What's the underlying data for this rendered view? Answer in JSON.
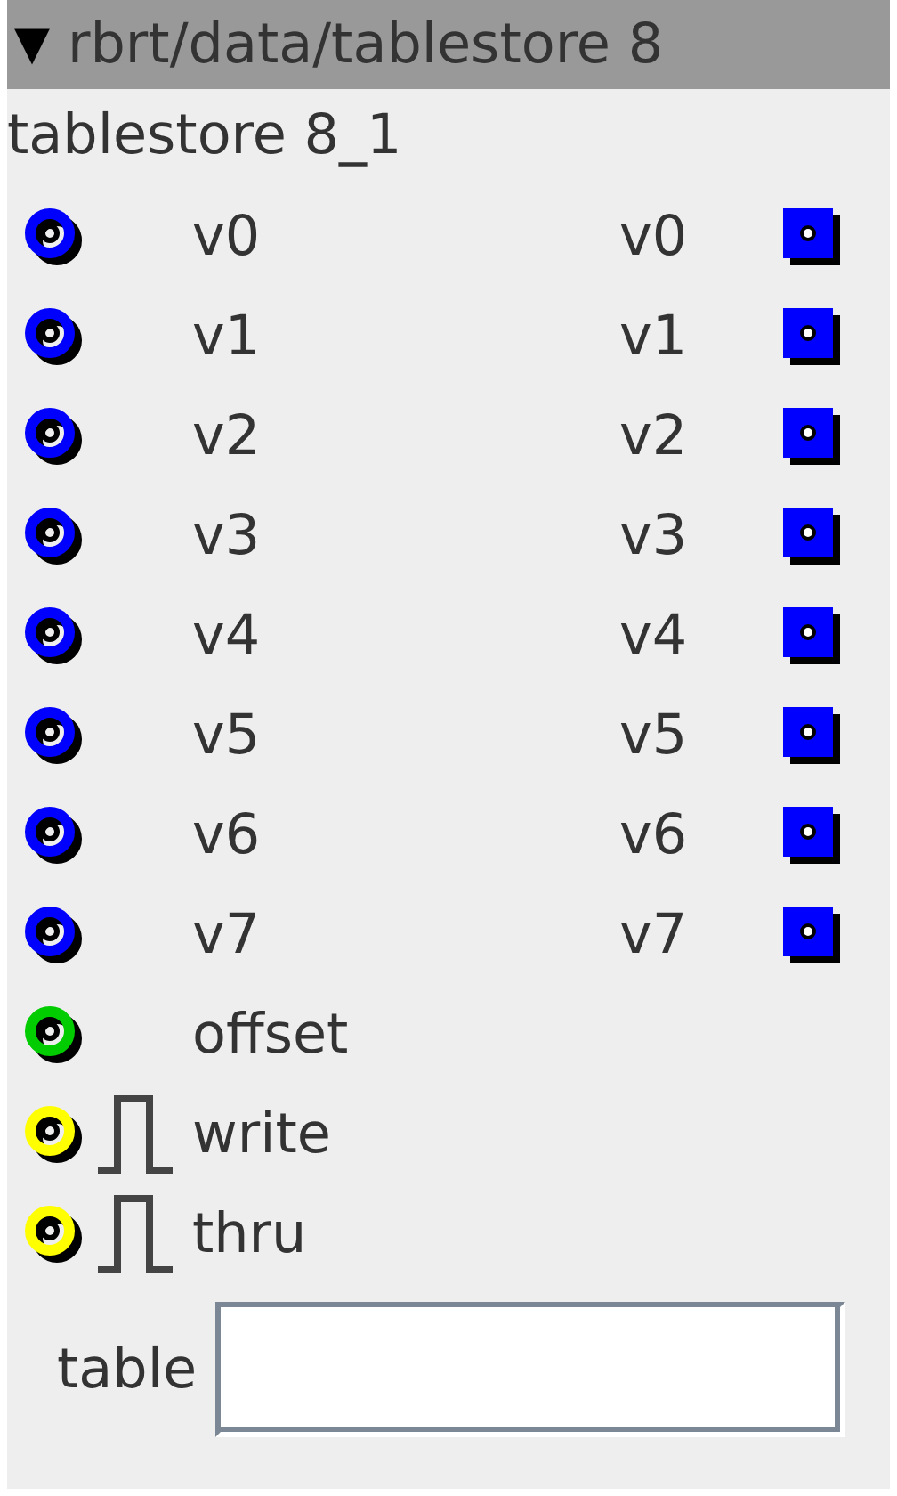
{
  "header": {
    "toggle": "▼",
    "title": "rbrt/data/tablestore 8"
  },
  "instance": "tablestore 8_1",
  "ports": [
    {
      "kind": "value",
      "color": "#0000ff",
      "label": "v0",
      "output": "v0"
    },
    {
      "kind": "value",
      "color": "#0000ff",
      "label": "v1",
      "output": "v1"
    },
    {
      "kind": "value",
      "color": "#0000ff",
      "label": "v2",
      "output": "v2"
    },
    {
      "kind": "value",
      "color": "#0000ff",
      "label": "v3",
      "output": "v3"
    },
    {
      "kind": "value",
      "color": "#0000ff",
      "label": "v4",
      "output": "v4"
    },
    {
      "kind": "value",
      "color": "#0000ff",
      "label": "v5",
      "output": "v5"
    },
    {
      "kind": "value",
      "color": "#0000ff",
      "label": "v6",
      "output": "v6"
    },
    {
      "kind": "value",
      "color": "#0000ff",
      "label": "v7",
      "output": "v7"
    },
    {
      "kind": "value",
      "color": "#00cc00",
      "label": "offset"
    },
    {
      "kind": "trigger",
      "color": "#ffff00",
      "label": "write"
    },
    {
      "kind": "trigger",
      "color": "#ffff00",
      "label": "thru"
    }
  ],
  "attribute": {
    "label": "table"
  }
}
